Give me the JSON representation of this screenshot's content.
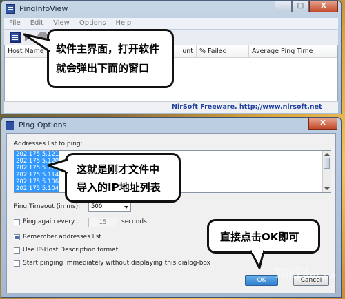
{
  "main_window": {
    "title": "PingInfoView",
    "menus": [
      "File",
      "Edit",
      "View",
      "Options",
      "Help"
    ],
    "columns": [
      "Host Name",
      "Count",
      "% Failed",
      "Average Ping Time"
    ],
    "column_partial": "unt",
    "status_text": "NirSoft Freeware.  http://www.nirsoft.net",
    "window_buttons": [
      "–",
      "□",
      "X"
    ]
  },
  "dialog": {
    "title": "Ping Options",
    "addresses_label": "Addresses list to ping:",
    "addresses": [
      "202.175.5.121",
      "202.175.5.120",
      "202.175.5.120",
      "202.175.5.114",
      "202.175.5.106",
      "202.175.5.104"
    ],
    "timeout_label": "Ping Timeout (in ms):",
    "timeout_value": "500",
    "ping_again_label": "Ping again every...",
    "ping_again_value": "15",
    "seconds_label": "seconds",
    "remember_label": "Remember addresses list",
    "description_label": "Use IP-Host Description format",
    "start_label": "Start pinging immediately without displaying this dialog-box",
    "ok_label": "OK",
    "cancel_label": "Cancel",
    "close_label": "X"
  },
  "callouts": {
    "c1_line1": "软件主界面，打开软件",
    "c1_line2": "就会弹出下面的窗口",
    "c2_line1": "这就是刚才文件中",
    "c2_line2": "导入的IP地址列表",
    "c3": "直接点击OK即可"
  },
  "watermark": {
    "top": "中关村在线",
    "bottom": "zol.com.cn"
  }
}
